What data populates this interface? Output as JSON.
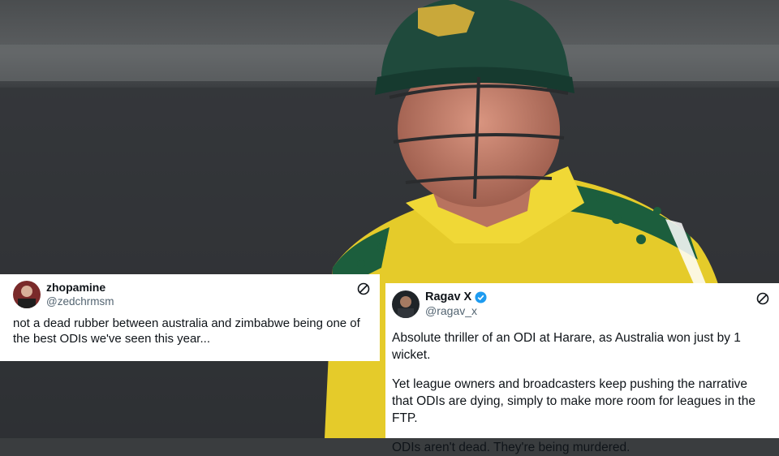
{
  "photo": {
    "description_icon": "cricket-batter-photo",
    "colors": {
      "jersey": "#e7cf2c",
      "helmet": "#214a3b",
      "background": "#3a3d3f"
    }
  },
  "tweets": [
    {
      "display_name": "zhopamine",
      "handle": "@zedchrmsm",
      "verified": false,
      "paragraphs": [
        "not a dead rubber between australia and zimbabwe being one of the best ODIs we've seen this year..."
      ]
    },
    {
      "display_name": "Ragav X",
      "handle": "@ragav_x",
      "verified": true,
      "paragraphs": [
        "Absolute thriller of an ODI at Harare, as Australia won just by 1 wicket.",
        "Yet league owners and broadcasters keep pushing the narrative that ODIs are dying, simply to make more room for leagues in the FTP.",
        "ODIs aren't dead. They're being murdered."
      ]
    }
  ]
}
